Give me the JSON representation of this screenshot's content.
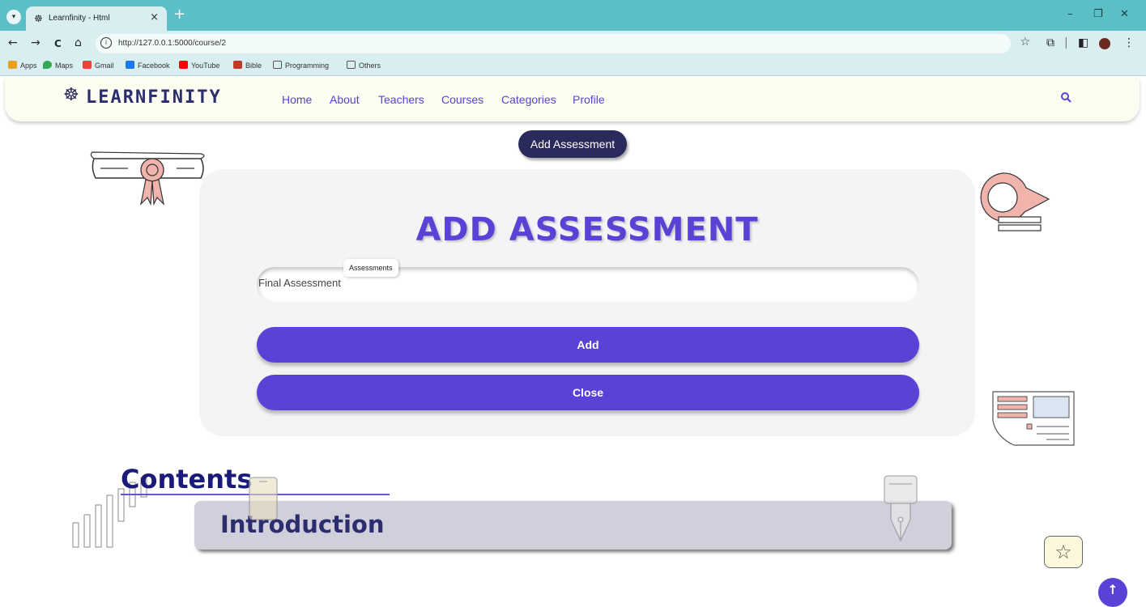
{
  "browser": {
    "tab_title": "Learnfinity - Html",
    "new_tab": "+",
    "tab_close": "×",
    "url": "http://127.0.0.1:5000/course/2",
    "window_controls": {
      "minimize": "–",
      "restore": "❐",
      "close": "✕"
    },
    "nav": {
      "back": "←",
      "forward": "→",
      "reload": "C",
      "home": "⌂"
    },
    "bookmarks": [
      {
        "label": "Apps",
        "color": "#e6a21c"
      },
      {
        "label": "Maps",
        "color": "#34a853"
      },
      {
        "label": "Gmail",
        "color": "#ea4335"
      },
      {
        "label": "Facebook",
        "color": "#1877f2"
      },
      {
        "label": "YouTube",
        "color": "#ff0000"
      },
      {
        "label": "Bible",
        "color": "#c0392b"
      },
      {
        "label": "Programming",
        "color": "#555555"
      },
      {
        "label": "Others",
        "color": "#555555"
      }
    ]
  },
  "site": {
    "logo_text": "LEARNFINITY",
    "nav_links": [
      "Home",
      "About",
      "Teachers",
      "Courses",
      "Categories",
      "Profile"
    ],
    "accent_color": "#5b41d6",
    "dark_color": "#2b2a5c"
  },
  "pill_button": "Add Assessment",
  "modal": {
    "title": "ADD ASSESSMENT",
    "field_label": "Assessments",
    "field_value": "Final Assessment",
    "add_button": "Add",
    "close_button": "Close"
  },
  "contents": {
    "heading": "Contents",
    "items": [
      "Introduction"
    ]
  },
  "icons": {
    "favorite": "star-outline-icon",
    "scroll_top": "arrow-up-icon"
  }
}
